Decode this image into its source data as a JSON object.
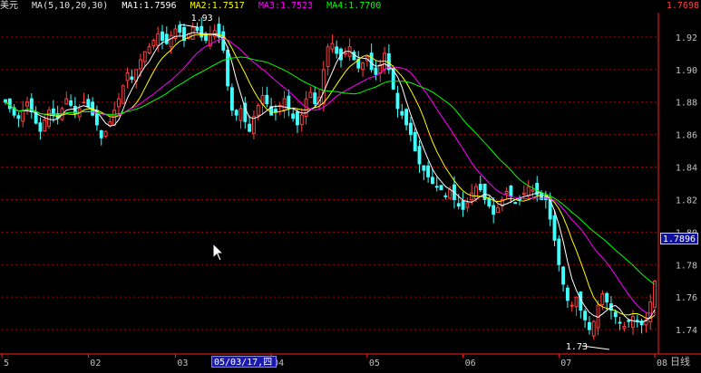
{
  "header": {
    "symbol": "美元",
    "indicator": "MA(5,10,20,30)",
    "ma1": "MA1:1.7596",
    "ma2": "MA2:1.7517",
    "ma3": "MA3:1.7523",
    "ma4": "MA4:1.7700",
    "last_value": "1.7698"
  },
  "colors": {
    "background": "#000000",
    "bull_candle": "#ff4040",
    "bear_candle": "#40ffff",
    "ma1": "#ffffff",
    "ma2": "#ffff00",
    "ma3": "#ff00ff",
    "ma4": "#00ff00",
    "grid": "#a00000",
    "axis": "#ff2020",
    "price_labels": "#c0c0c0"
  },
  "cursor": {
    "price_readout": "1.7896",
    "date_readout": "05/03/17,四"
  },
  "period_label": "日线",
  "annotations": [
    {
      "text": "1.93",
      "price": 1.93
    },
    {
      "text": "1.73",
      "price": 1.73
    }
  ],
  "chart_data": {
    "type": "candlestick",
    "title": "",
    "ylim": [
      1.725,
      1.935
    ],
    "y_ticks": [
      "1.92",
      "1.90",
      "1.88",
      "1.86",
      "1.84",
      "1.82",
      "1.80",
      "1.78",
      "1.76",
      "1.74"
    ],
    "x_ticks": [
      {
        "label": "5",
        "index": 0
      },
      {
        "label": "02",
        "index": 19
      },
      {
        "label": "03",
        "index": 39
      },
      {
        "label": "04",
        "index": 61
      },
      {
        "label": "05",
        "index": 83
      },
      {
        "label": "06",
        "index": 105
      },
      {
        "label": "07",
        "index": 127
      },
      {
        "label": "08",
        "index": 149
      }
    ],
    "series": [
      {
        "name": "Close",
        "values": [
          1.88,
          1.876,
          1.872,
          1.87,
          1.875,
          1.88,
          1.874,
          1.867,
          1.862,
          1.869,
          1.875,
          1.872,
          1.87,
          1.876,
          1.882,
          1.878,
          1.873,
          1.876,
          1.88,
          1.877,
          1.872,
          1.866,
          1.858,
          1.862,
          1.868,
          1.875,
          1.882,
          1.89,
          1.898,
          1.894,
          1.9,
          1.906,
          1.911,
          1.914,
          1.918,
          1.922,
          1.918,
          1.916,
          1.921,
          1.925,
          1.923,
          1.918,
          1.922,
          1.926,
          1.924,
          1.92,
          1.918,
          1.921,
          1.924,
          1.92,
          1.912,
          1.89,
          1.875,
          1.872,
          1.876,
          1.868,
          1.862,
          1.871,
          1.878,
          1.884,
          1.879,
          1.872,
          1.874,
          1.878,
          1.882,
          1.876,
          1.87,
          1.866,
          1.872,
          1.882,
          1.886,
          1.879,
          1.883,
          1.9,
          1.914,
          1.916,
          1.91,
          1.906,
          1.91,
          1.914,
          1.906,
          1.901,
          1.904,
          1.908,
          1.9,
          1.897,
          1.903,
          1.91,
          1.9,
          1.888,
          1.876,
          1.872,
          1.866,
          1.86,
          1.85,
          1.842,
          1.838,
          1.834,
          1.83,
          1.828,
          1.826,
          1.822,
          1.826,
          1.82,
          1.816,
          1.814,
          1.818,
          1.824,
          1.828,
          1.826,
          1.82,
          1.816,
          1.811,
          1.815,
          1.82,
          1.825,
          1.822,
          1.818,
          1.82,
          1.824,
          1.828,
          1.826,
          1.823,
          1.82,
          1.82,
          1.808,
          1.795,
          1.78,
          1.768,
          1.758,
          1.755,
          1.76,
          1.752,
          1.746,
          1.74,
          1.745,
          1.755,
          1.762,
          1.757,
          1.752,
          1.748,
          1.744,
          1.742,
          1.745,
          1.748,
          1.745,
          1.743,
          1.746,
          1.757,
          1.7698
        ]
      },
      {
        "name": "MA1",
        "period": 5
      },
      {
        "name": "MA2",
        "period": 10
      },
      {
        "name": "MA3",
        "period": 20
      },
      {
        "name": "MA4",
        "period": 30
      }
    ],
    "grid": true,
    "legend": "top-left"
  }
}
